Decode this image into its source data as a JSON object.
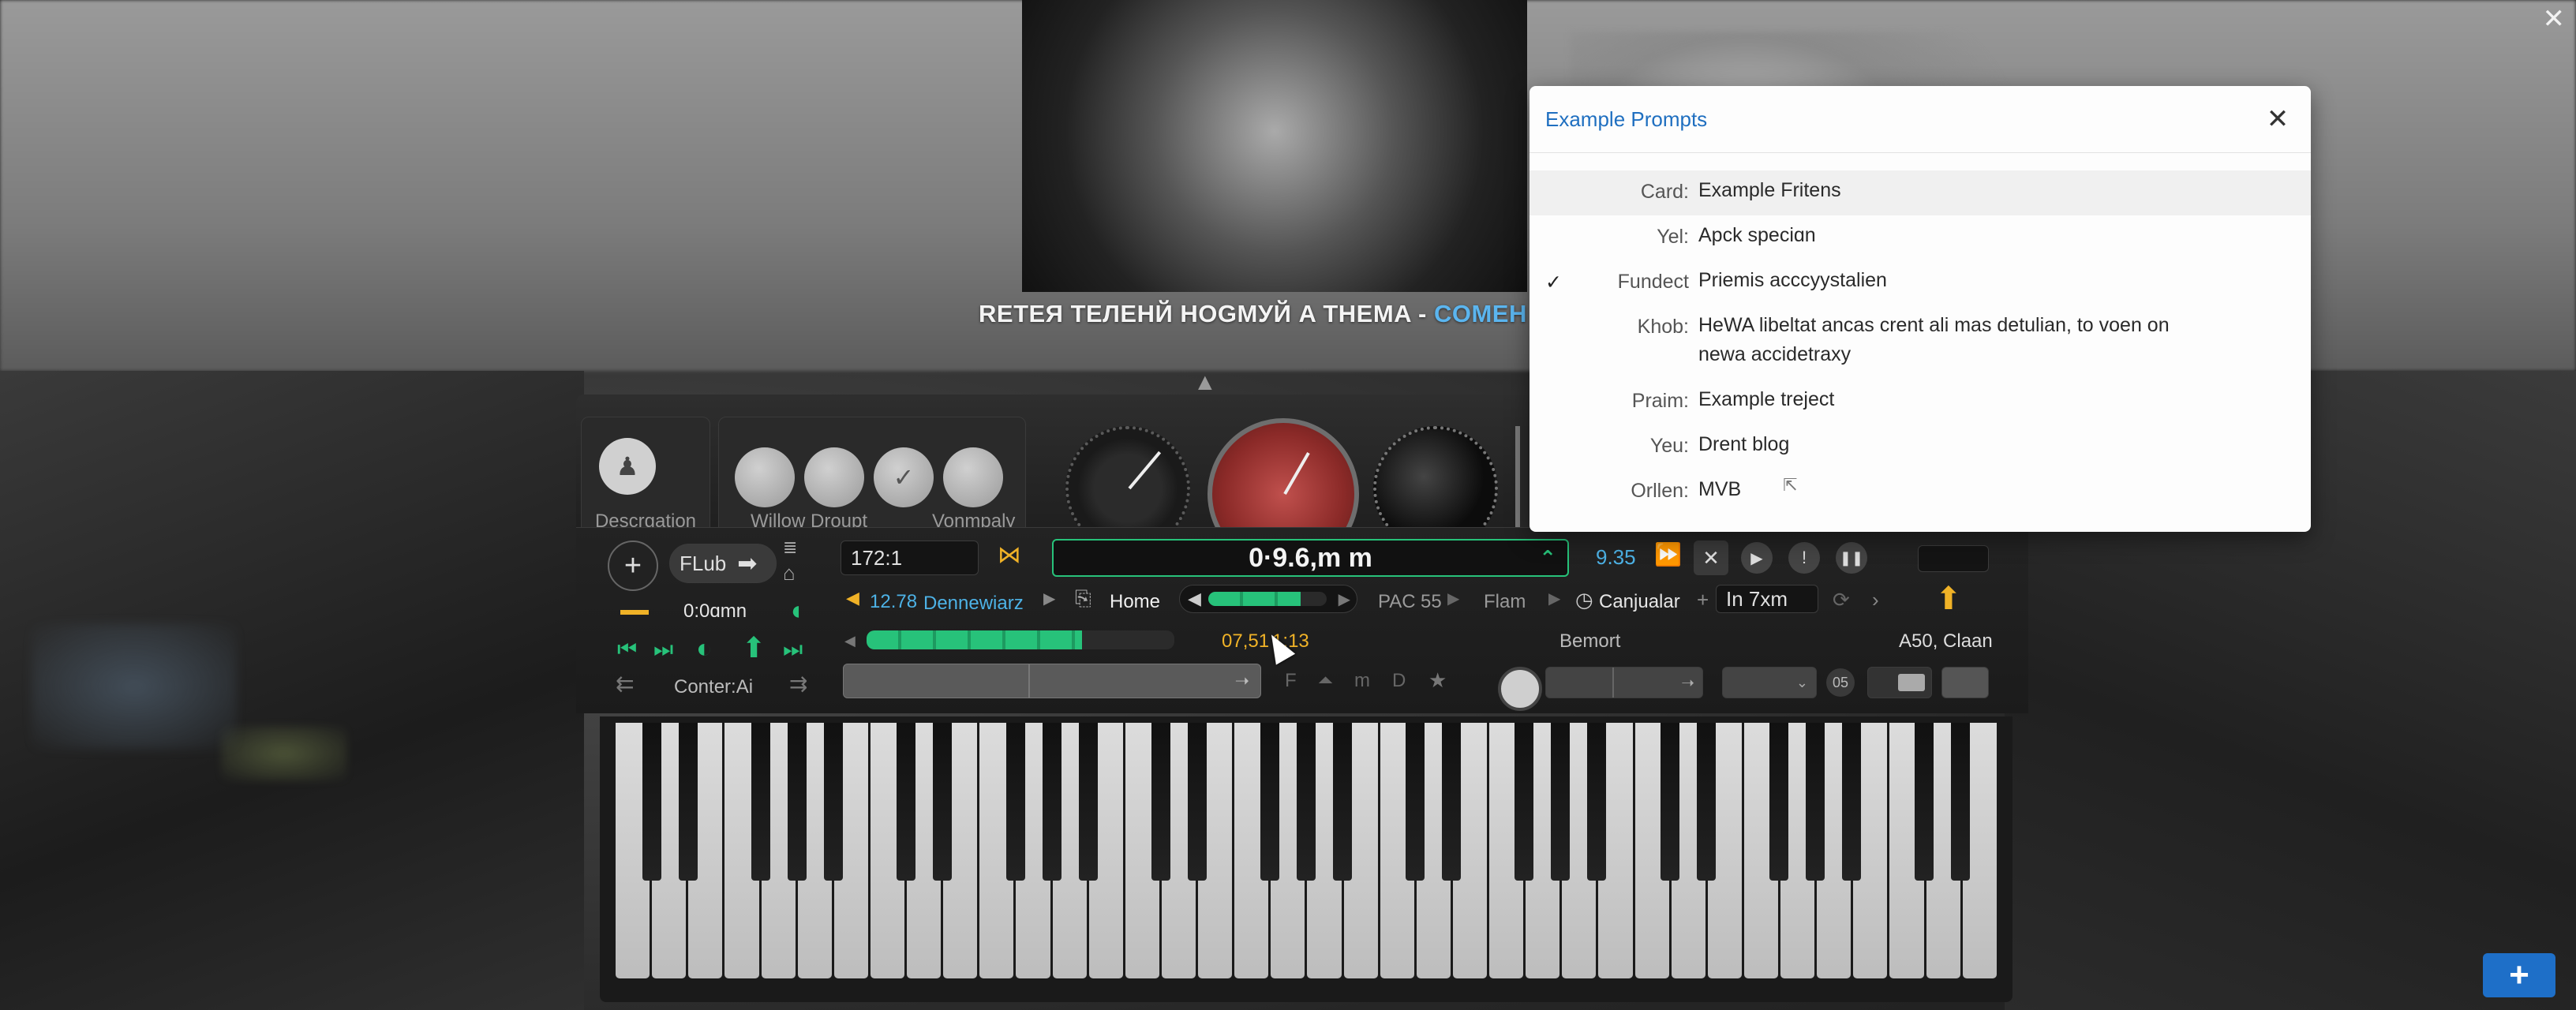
{
  "headline": {
    "main": "RETEЯ ТЕЛЕНЙ HOGMУЙ A THEMA - ",
    "accent": "COMEH ИК"
  },
  "synth": {
    "sections": [
      {
        "label": "Descrgation"
      },
      {
        "label": "Willow Droupt"
      },
      {
        "label": "Vonmpaly"
      }
    ],
    "controls": {
      "flub_label": "FLub",
      "time_small": "0:0ɑmn",
      "counter_label": "Conter:Ai",
      "field_value": "172:1",
      "display_time": "0·9.6,m m",
      "display_aux": "9.35",
      "tempo_value": "12.78",
      "tempo_name": "Dennewiarz",
      "home_label": "Home",
      "pac_label": "PAC",
      "pac_value": "55",
      "flam_label": "Flam",
      "canjualar_label": "Canjualar",
      "in_field": "In  7xm",
      "position_time": "07,51 1:13",
      "bemort_label": "Bemort",
      "a50_label": "A50, Claan",
      "num_badge": "05",
      "tempo_bar_level": 0.7,
      "meter_bar_level": 0.78
    }
  },
  "modal": {
    "title": "Example Prompts",
    "rows": [
      {
        "label": "Card:",
        "value": "Example Fritens",
        "checked": false
      },
      {
        "label": "Yel:",
        "value": "Apck speciɑn",
        "checked": false
      },
      {
        "label": "Fundect",
        "value": "Priemis acccyystalien",
        "checked": true
      },
      {
        "label": "Khob:",
        "value": "HeWA libeltat ancas crent ali mas detulian, to voen on newa accidetraxy",
        "checked": false
      },
      {
        "label": "Praim:",
        "value": "Example treject",
        "checked": false
      },
      {
        "label": "Yeu:",
        "value": "Drent blog",
        "checked": false
      },
      {
        "label": "Orllen:",
        "value": "MVB",
        "checked": false
      }
    ]
  },
  "colors": {
    "accent_blue": "#1f6fc0",
    "green": "#27c27a",
    "yellow": "#f0b227",
    "knob_red": "#8b2a28"
  }
}
